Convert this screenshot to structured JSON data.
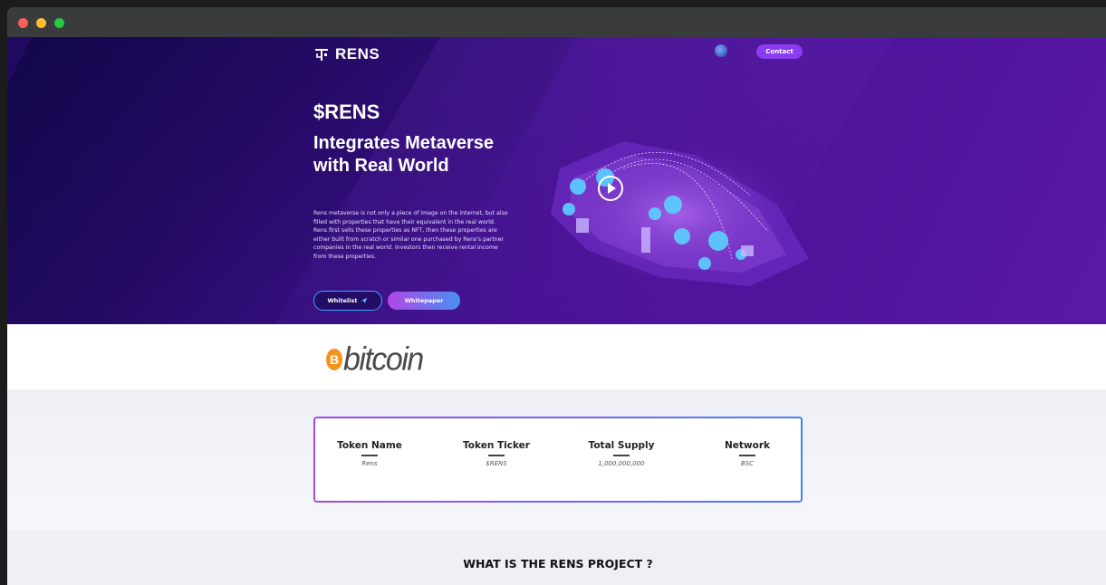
{
  "header": {
    "brand": "RENS",
    "contact_label": "Contact",
    "globe_icon": "globe-icon"
  },
  "hero": {
    "ticker": "$RENS",
    "headline": "Integrates Metaverse with Real World",
    "description": "Rens metaverse is not only a piece of image on the internet, but also filled with properties that have their equivalent in the real world. Rens first sells these properties as NFT, then these properties are either built from scratch or similar one purchased by Rens's partner companies in the real world. Investors then receive rental income from these properties.",
    "whitelist_label": "Whitelist",
    "whitepaper_label": "Whitepaper",
    "play_icon": "play-icon"
  },
  "sponsor": {
    "coin_symbol": "B",
    "name": "bitcoin"
  },
  "token_info": [
    {
      "label": "Token Name",
      "value": "Rens"
    },
    {
      "label": "Token Ticker",
      "value": "$RENS"
    },
    {
      "label": "Total Supply",
      "value": "1,000,000,000"
    },
    {
      "label": "Network",
      "value": "BSC"
    }
  ],
  "about": {
    "title": "WHAT IS THE RENS PROJECT ?"
  },
  "colors": {
    "accent": "#8a3cf0",
    "hero_dark": "#1f0a5e",
    "hero_light": "#5a18a6",
    "bitcoin": "#f7931a"
  }
}
